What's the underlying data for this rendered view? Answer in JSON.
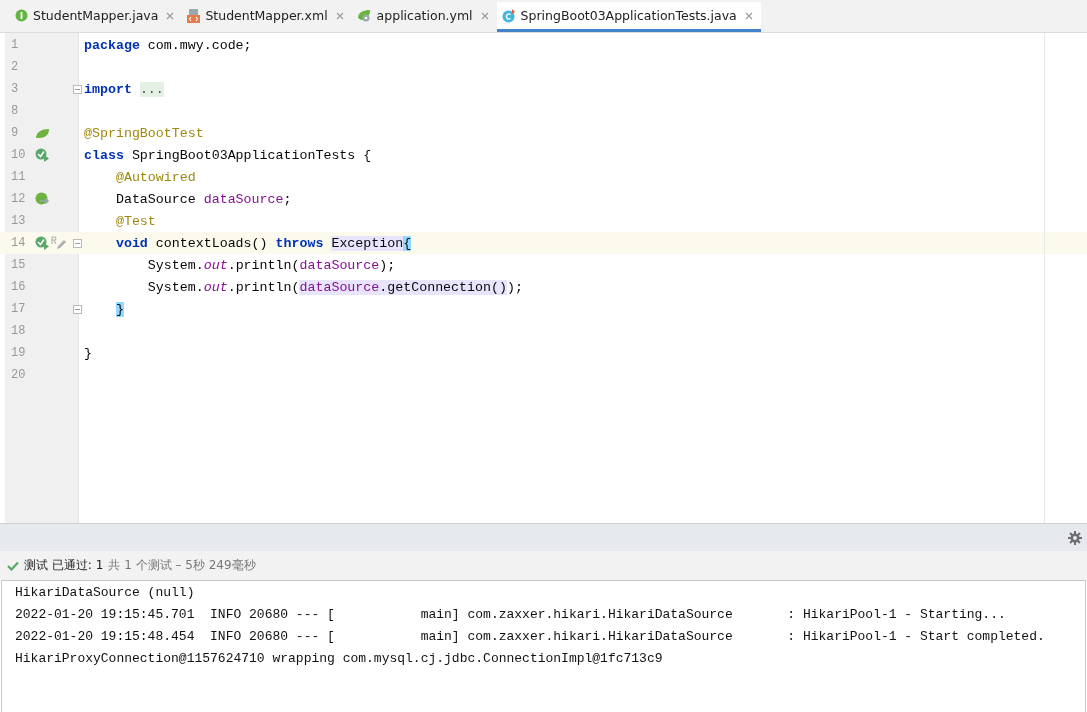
{
  "tabs": [
    {
      "label": "StudentMapper.java",
      "kind": "interface",
      "selected": false
    },
    {
      "label": "StudentMapper.xml",
      "kind": "xml",
      "selected": false
    },
    {
      "label": "application.yml",
      "kind": "yml",
      "selected": false
    },
    {
      "label": "SpringBoot03ApplicationTests.java",
      "kind": "class",
      "selected": true
    }
  ],
  "editor": {
    "lines": [
      {
        "number": "1",
        "current": false,
        "fold": false,
        "tokens": [
          {
            "t": "package",
            "kind": "kw"
          },
          {
            "t": " com.mwy.code;",
            "kind": "plain"
          }
        ]
      },
      {
        "number": "2",
        "current": false,
        "fold": false
      },
      {
        "number": "3",
        "current": false,
        "fold": true,
        "tokens": [
          {
            "t": "import",
            "kind": "kw"
          },
          {
            "t": " ...",
            "kind": "folded"
          }
        ]
      },
      {
        "number": "8",
        "current": false,
        "fold": false
      },
      {
        "number": "9",
        "current": false,
        "fold": false,
        "gutter_icons": [
          {
            "kind": "bean"
          }
        ],
        "tokens": [
          {
            "t": "@SpringBootTest",
            "kind": "ann"
          }
        ]
      },
      {
        "number": "10",
        "current": false,
        "fold": false,
        "gutter_icons": [
          {
            "kind": "run"
          }
        ],
        "tokens": [
          {
            "t": "class",
            "kind": "kw"
          },
          {
            "t": " SpringBoot03ApplicationTests {",
            "kind": "plain"
          }
        ]
      },
      {
        "number": "11",
        "current": false,
        "fold": false,
        "tokens": [
          {
            "t": "    @Autowired",
            "kind": "ann"
          }
        ]
      },
      {
        "number": "12",
        "current": false,
        "fold": false,
        "gutter_icons": [
          {
            "kind": "inject"
          }
        ],
        "tokens": [
          {
            "t": "    DataSource ",
            "kind": "plain"
          },
          {
            "t": "dataSource",
            "kind": "field"
          },
          {
            "t": ";",
            "kind": "plain"
          }
        ]
      },
      {
        "number": "13",
        "current": false,
        "fold": false,
        "tokens": [
          {
            "t": "    @Test",
            "kind": "ann"
          }
        ]
      },
      {
        "number": "14",
        "current": true,
        "fold": true,
        "gutter_icons": [
          {
            "kind": "run"
          },
          {
            "kind": "edit"
          }
        ],
        "tokens": [
          {
            "t": "    void",
            "kind": "kw"
          },
          {
            "t": " contextLoads() ",
            "kind": "plain"
          },
          {
            "t": "throws",
            "kind": "kw"
          },
          {
            "t": " Exception",
            "kind": "usage"
          },
          {
            "t": "{",
            "kind": "brace"
          }
        ]
      },
      {
        "number": "15",
        "current": false,
        "fold": false,
        "tokens": [
          {
            "t": "        System.",
            "kind": "plain"
          },
          {
            "t": "out",
            "kind": "static"
          },
          {
            "t": ".println(",
            "kind": "plain"
          },
          {
            "t": "dataSource",
            "kind": "field"
          },
          {
            "t": ");",
            "kind": "plain"
          }
        ]
      },
      {
        "number": "16",
        "current": false,
        "fold": false,
        "tokens": [
          {
            "t": "        System.",
            "kind": "plain"
          },
          {
            "t": "out",
            "kind": "static"
          },
          {
            "t": ".println(",
            "kind": "plain"
          },
          {
            "t": "dataSource",
            "kind": "field-usage"
          },
          {
            "t": ".getConnection()",
            "kind": "usage"
          },
          {
            "t": ");",
            "kind": "plain"
          }
        ]
      },
      {
        "number": "17",
        "current": false,
        "fold": true,
        "tokens": [
          {
            "t": "    }",
            "kind": "brace"
          }
        ]
      },
      {
        "number": "18",
        "current": false,
        "fold": false
      },
      {
        "number": "19",
        "current": false,
        "fold": false,
        "tokens": [
          {
            "t": "}",
            "kind": "plain"
          }
        ]
      },
      {
        "number": "20",
        "current": false,
        "fold": false
      }
    ]
  },
  "test_status": {
    "passed": true,
    "label": "测试 已通过:",
    "count": "1",
    "detail": "共 1 个测试 – 5秒 249毫秒"
  },
  "console": [
    "HikariDataSource (null)",
    "2022-01-20 19:15:45.701  INFO 20680 --- [           main] com.zaxxer.hikari.HikariDataSource       : HikariPool-1 - Starting...",
    "2022-01-20 19:15:48.454  INFO 20680 --- [           main] com.zaxxer.hikari.HikariDataSource       : HikariPool-1 - Start completed.",
    "HikariProxyConnection@1157624710 wrapping com.mysql.cj.jdbc.ConnectionImpl@1fc713c9"
  ]
}
